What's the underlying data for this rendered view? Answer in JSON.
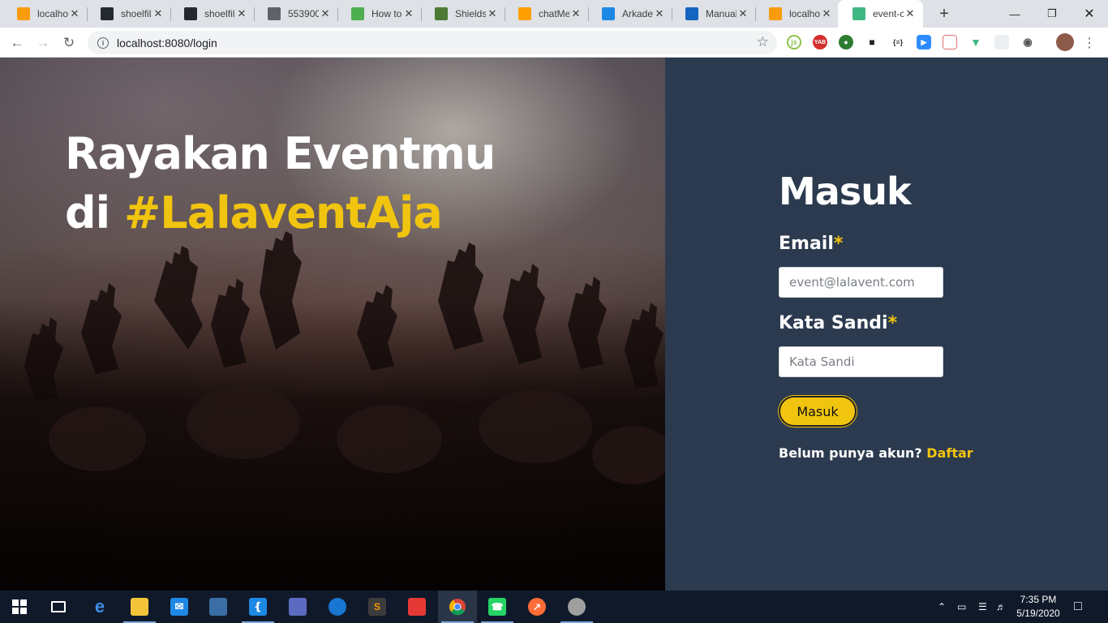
{
  "browser": {
    "tabs": [
      {
        "label": "localho",
        "icon": "pma-icon",
        "color": "#f89c0e"
      },
      {
        "label": "shoelfil",
        "icon": "github-icon",
        "color": "#24292e"
      },
      {
        "label": "shoelfil",
        "icon": "github-icon",
        "color": "#24292e"
      },
      {
        "label": "553900",
        "icon": "globe-icon",
        "color": "#5f6368"
      },
      {
        "label": "How to",
        "icon": "w3-icon",
        "color": "#4caf50"
      },
      {
        "label": "Shields",
        "icon": "shields-icon",
        "color": "#4c7a34"
      },
      {
        "label": "chatMe",
        "icon": "firebase-icon",
        "color": "#ffa000"
      },
      {
        "label": "Arkade",
        "icon": "arkademy-icon",
        "color": "#1e88e5"
      },
      {
        "label": "Manual",
        "icon": "docs-icon",
        "color": "#1565c0"
      },
      {
        "label": "localho",
        "icon": "pma-icon",
        "color": "#f89c0e"
      },
      {
        "label": "event-c",
        "icon": "vue-icon",
        "color": "#41b883",
        "active": true
      }
    ],
    "url": "localhost:8080/login"
  },
  "hero": {
    "line1": "Rayakan Eventmu",
    "line2_prefix": "di ",
    "line2_accent": "#LalaventAja"
  },
  "login": {
    "title": "Masuk",
    "email_label": "Email",
    "email_required": "*",
    "email_placeholder": "event@lalavent.com",
    "password_label": "Kata Sandi",
    "password_required": "*",
    "password_placeholder": "Kata Sandi",
    "submit_label": "Masuk",
    "signup_prompt": "Belum punya akun?",
    "signup_link": "Daftar"
  },
  "colors": {
    "accent": "#f1c40f",
    "panel": "#2c3a4f"
  },
  "taskbar": {
    "time": "7:35 PM",
    "date": "5/19/2020"
  }
}
